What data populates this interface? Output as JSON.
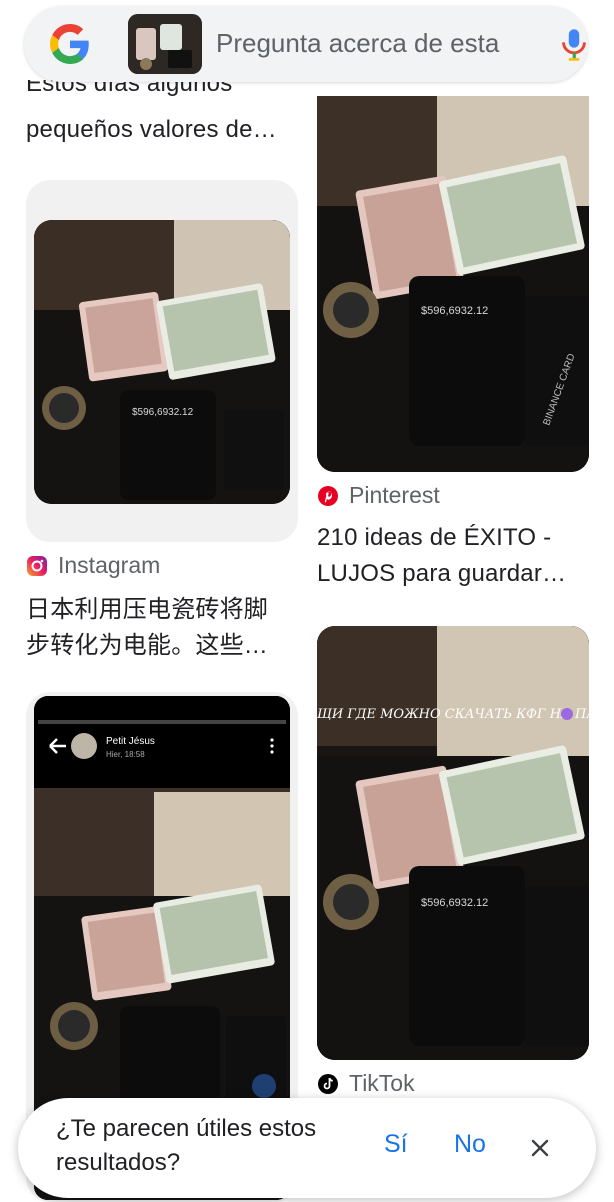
{
  "search": {
    "placeholder": "Pregunta acerca de esta imagen",
    "display_text": "Pregunta acerca de esta"
  },
  "results": {
    "left": [
      {
        "title_partial_hidden": "Estos días algunos",
        "title": "pequeños valores de…"
      },
      {
        "source": "Instagram",
        "title_line1": "日本利用压电瓷砖将脚",
        "title_line2": "步转化为电能。这些…"
      },
      {
        "caption_top_user": "Petit Jésus",
        "caption_top_time": "Hier, 18:58"
      }
    ],
    "right": [
      {
        "source": "Pinterest",
        "title_line1": "210 ideas de ÉXITO -",
        "title_line2": "LUJOS para guardar…"
      },
      {
        "overlay": "ЩИ ГДЕ МОЖНО СКАЧАТЬ КФГ НА ПАБГ?",
        "source": "TikTok"
      }
    ]
  },
  "phone_screen": {
    "balance": "$596,6932.12",
    "card_label": "BINANCE CARD"
  },
  "feedback": {
    "question_line1": "¿Te parecen útiles estos",
    "question_line2": "resultados?",
    "yes_label": "Sí",
    "no_label": "No"
  },
  "colors": {
    "accent": "#1a73e8",
    "instagram": "#d6249f",
    "pinterest": "#e60023",
    "tiktok": "#000000"
  }
}
